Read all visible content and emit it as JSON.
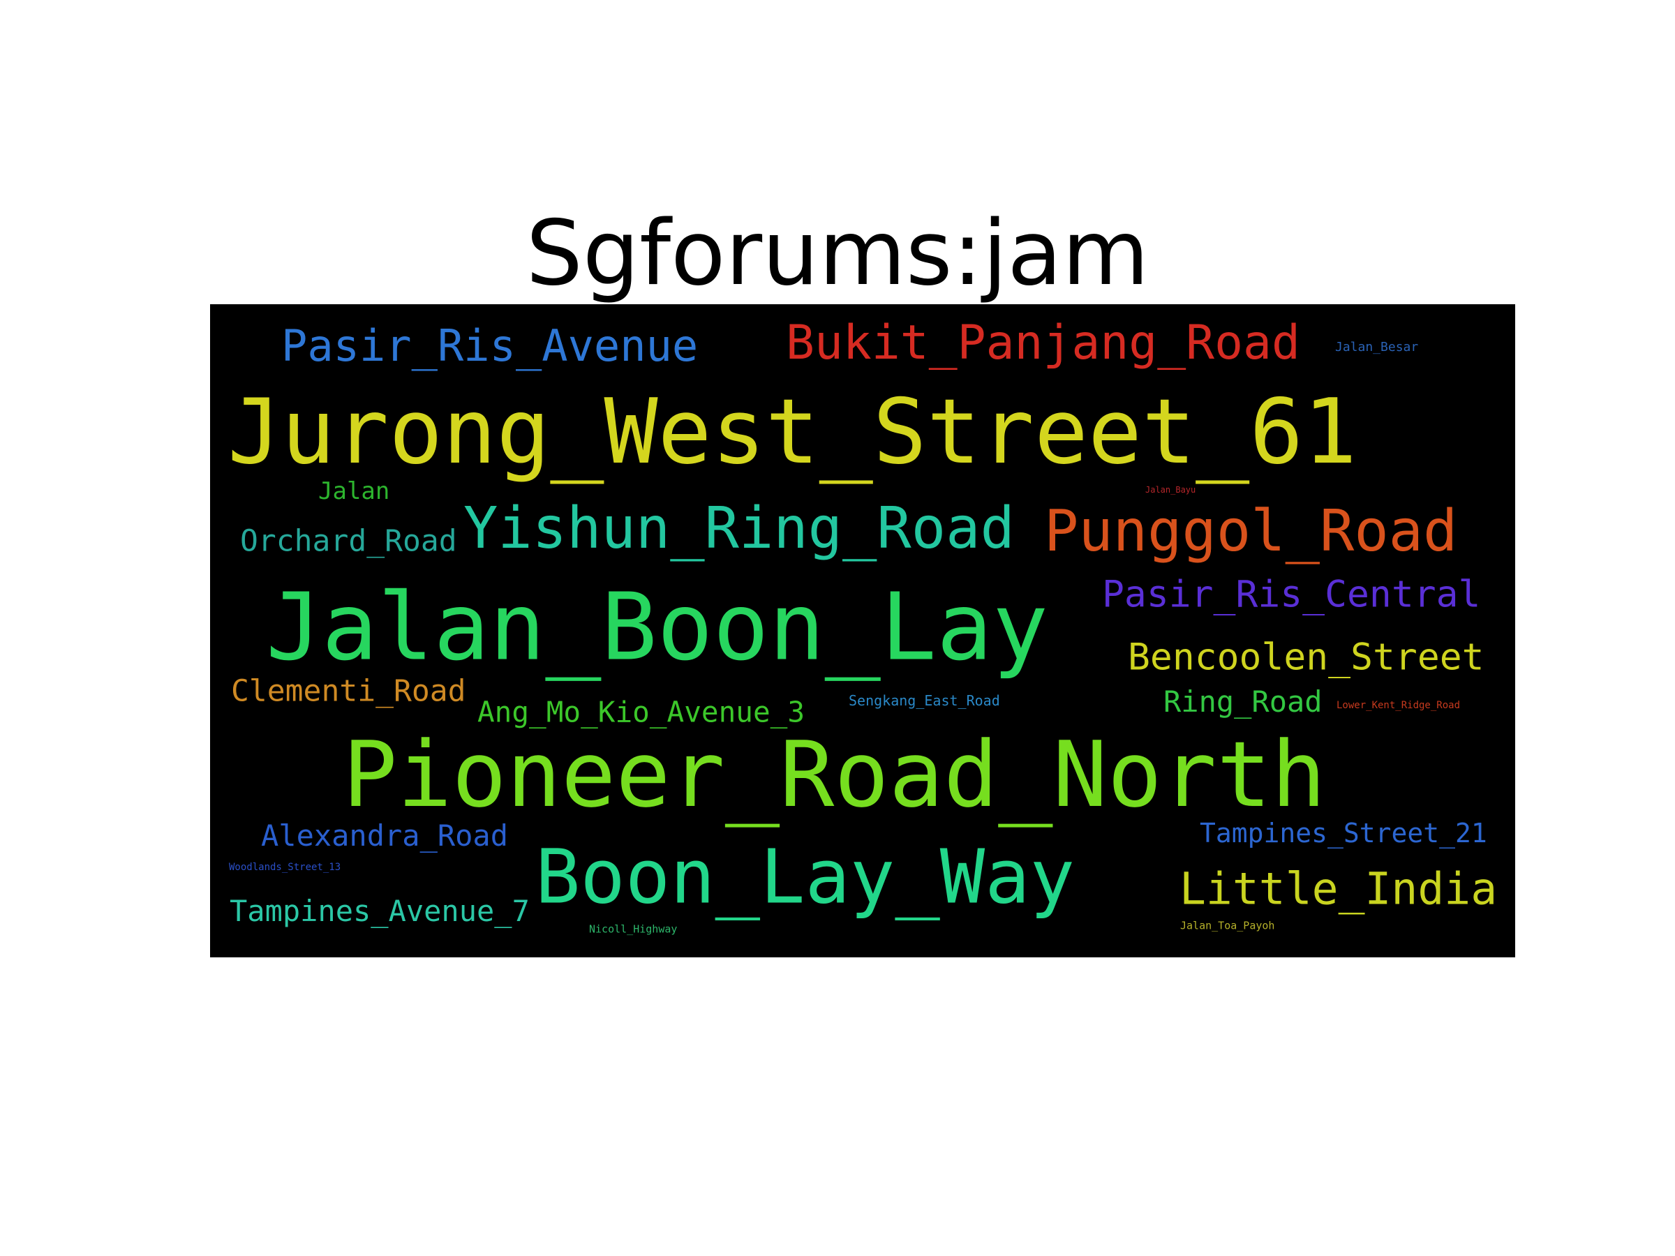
{
  "title": "Sgforums:jam",
  "words": [
    {
      "text": "Jurong_West_Street_61",
      "color": "#d4d61e"
    },
    {
      "text": "Jalan_Boon_Lay",
      "color": "#27d65f"
    },
    {
      "text": "Pioneer_Road_North",
      "color": "#76de1f"
    },
    {
      "text": "Boon_Lay_Way",
      "color": "#22d68a"
    },
    {
      "text": "Yishun_Ring_Road",
      "color": "#23c7a0"
    },
    {
      "text": "Punggol_Road",
      "color": "#d9521c"
    },
    {
      "text": "Bukit_Panjang_Road",
      "color": "#d62b22"
    },
    {
      "text": "Pasir_Ris_Avenue",
      "color": "#2e77d6"
    },
    {
      "text": "Little_India",
      "color": "#c9d420"
    },
    {
      "text": "Pasir_Ris_Central",
      "color": "#5a2fd6"
    },
    {
      "text": "Bencoolen_Street",
      "color": "#cfd41f"
    },
    {
      "text": "Orchard_Road",
      "color": "#26a89a"
    },
    {
      "text": "Clementi_Road",
      "color": "#cf8a24"
    },
    {
      "text": "Alexandra_Road",
      "color": "#2a5fcf"
    },
    {
      "text": "Tampines_Avenue_7",
      "color": "#2bc7a6"
    },
    {
      "text": "Ang_Mo_Kio_Avenue_3",
      "color": "#3cc72a"
    },
    {
      "text": "Ring_Road",
      "color": "#33c742"
    },
    {
      "text": "Tampines_Street_21",
      "color": "#2c66d1"
    },
    {
      "text": "Jalan",
      "color": "#2db52e"
    },
    {
      "text": "Jalan_Besar",
      "color": "#2a62b5"
    },
    {
      "text": "Jalan_Bayu",
      "color": "#b5262a"
    },
    {
      "text": "Sengkang_East_Road",
      "color": "#2a88c7"
    },
    {
      "text": "Lower_Kent_Ridge_Road",
      "color": "#c73a1e"
    },
    {
      "text": "Woodlands_Street_13",
      "color": "#2a4fc7"
    },
    {
      "text": "Nicoll_Highway",
      "color": "#2db56a"
    },
    {
      "text": "Jalan_Toa_Payoh",
      "color": "#b5b02a"
    }
  ]
}
